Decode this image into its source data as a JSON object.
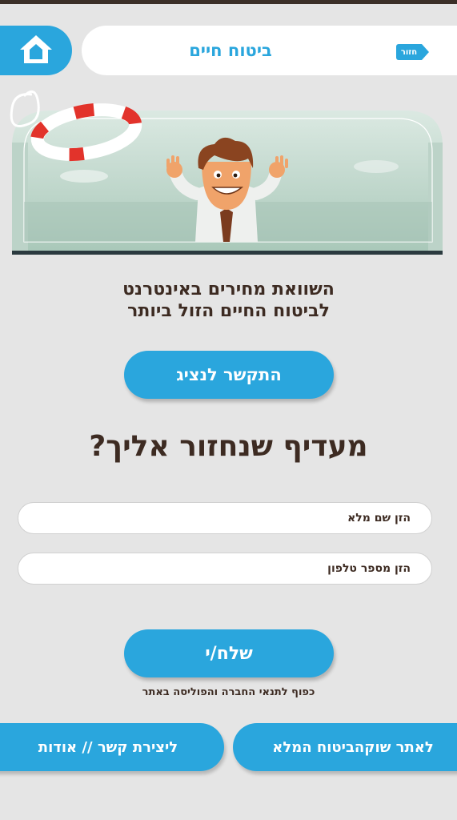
{
  "header": {
    "title": "ביטוח חיים",
    "back_label": "חזור"
  },
  "main": {
    "headline_line1": "השוואת מחירים באינטרנט",
    "headline_line2": "לביטוח החיים הזול ביותר",
    "call_button": "התקשר לנציג",
    "question": "מעדיף שנחזור אליך?",
    "name_placeholder": "הזן שם מלא",
    "phone_placeholder": "הזן מספר טלפון",
    "send_button": "שלח/י",
    "terms_text": "כפוף לתנאי החברה והפוליסה באתר"
  },
  "footer": {
    "site_button": "לאתר שוקהביטוח המלא",
    "contact_button": "ליצירת קשר // אודות"
  },
  "colors": {
    "accent": "#2aa6dd",
    "text_dark": "#3d2b22",
    "background": "#e5e5e5"
  }
}
